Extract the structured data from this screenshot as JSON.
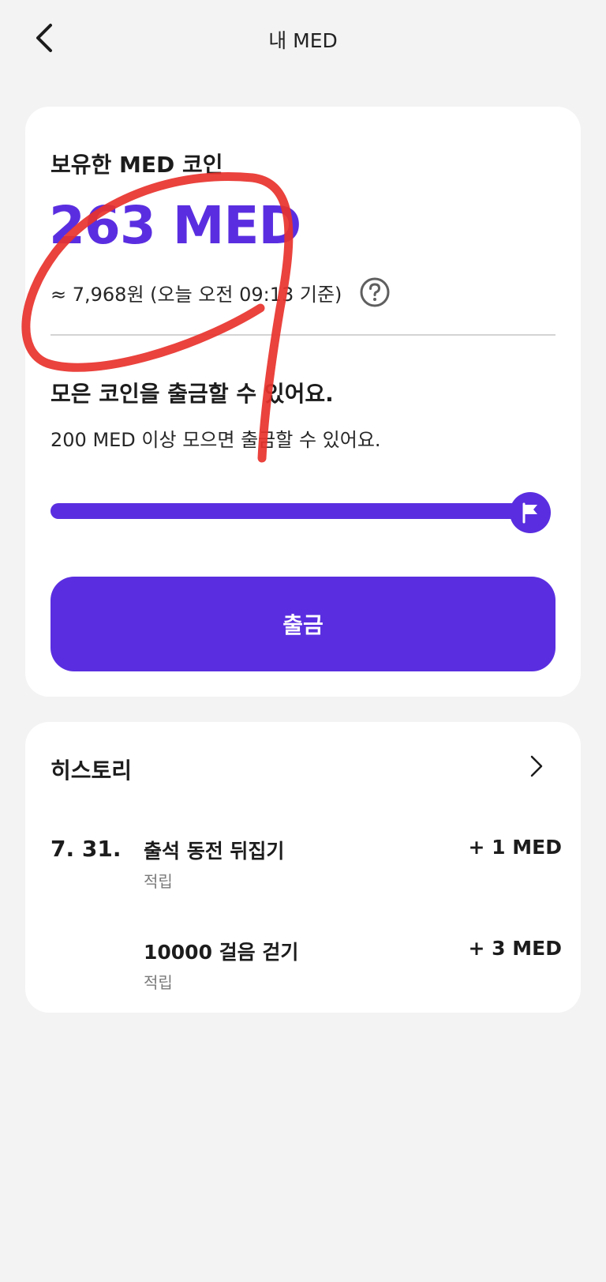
{
  "header": {
    "title": "내 MED",
    "back_icon": "chevron-left-icon"
  },
  "balance": {
    "label": "보유한 MED 코인",
    "amount": "263 MED",
    "fiat_text": "≈ 7,968원 (오늘 오전 09:13 기준)",
    "help_icon": "question-circle-icon"
  },
  "withdraw": {
    "title": "모은 코인을 출금할 수 있어요.",
    "description": "200 MED 이상 모으면 출금할 수 있어요.",
    "progress": 1.0,
    "goal_icon": "flag-icon",
    "button_label": "출금"
  },
  "history": {
    "title": "히스토리",
    "more_icon": "chevron-right-icon",
    "date": "7. 31.",
    "items": [
      {
        "title": "출석 동전 뒤집기",
        "type": "적립",
        "amount": "+ 1 MED"
      },
      {
        "title": "10000 걸음 걷기",
        "type": "적립",
        "amount": "+ 3 MED"
      }
    ]
  },
  "colors": {
    "accent": "#5a2ee0",
    "annotation": "#e8322c",
    "background": "#f3f3f3"
  }
}
